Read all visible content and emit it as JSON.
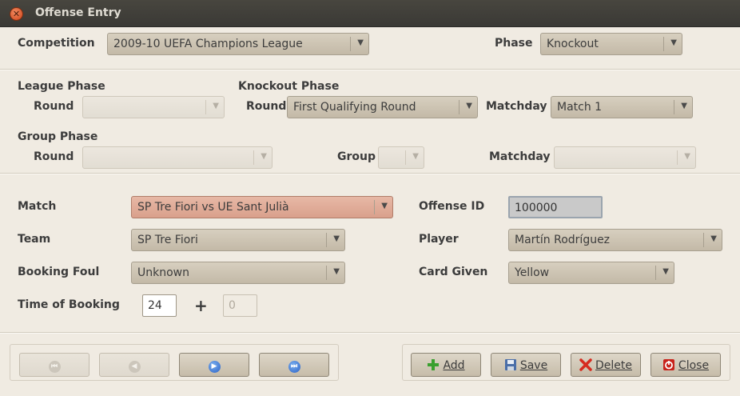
{
  "window": {
    "title": "Offense Entry"
  },
  "competition": {
    "label": "Competition",
    "value": "2009-10 UEFA Champions League"
  },
  "phase": {
    "label": "Phase",
    "value": "Knockout"
  },
  "league_phase": {
    "heading": "League Phase",
    "round_label": "Round",
    "round_value": ""
  },
  "knockout_phase": {
    "heading": "Knockout Phase",
    "round_label": "Round",
    "round_value": "First Qualifying Round",
    "matchday_label": "Matchday",
    "matchday_value": "Match 1"
  },
  "group_phase": {
    "heading": "Group Phase",
    "round_label": "Round",
    "round_value": "",
    "group_label": "Group",
    "group_value": "",
    "matchday_label": "Matchday",
    "matchday_value": ""
  },
  "match": {
    "label": "Match",
    "value": "SP Tre Fiori vs UE Sant Julià"
  },
  "offense_id": {
    "label": "Offense ID",
    "value": "100000"
  },
  "team": {
    "label": "Team",
    "value": "SP Tre Fiori"
  },
  "player": {
    "label": "Player",
    "value": "Martín Rodríguez"
  },
  "booking_foul": {
    "label": "Booking Foul",
    "value": "Unknown"
  },
  "card_given": {
    "label": "Card Given",
    "value": "Yellow"
  },
  "time_of_booking": {
    "label": "Time of Booking",
    "value": "24",
    "plus": "+",
    "stoppage_value": "0"
  },
  "actions": {
    "add": "Add",
    "save": "Save",
    "delete": "Delete",
    "close": "Close"
  },
  "colors": {
    "titlebar": "#3c3b37",
    "window_bg": "#f0ebe2",
    "button_face": "#d0c7b6",
    "match_highlight": "#dca692",
    "nav_blue": "#2a62c7"
  },
  "icons": {
    "close": "close-icon",
    "first": "first-record-icon",
    "prev": "previous-record-icon",
    "next": "next-record-icon",
    "last": "last-record-icon",
    "add": "add-icon",
    "save": "save-icon",
    "delete": "delete-icon",
    "close_action": "close-action-icon"
  }
}
